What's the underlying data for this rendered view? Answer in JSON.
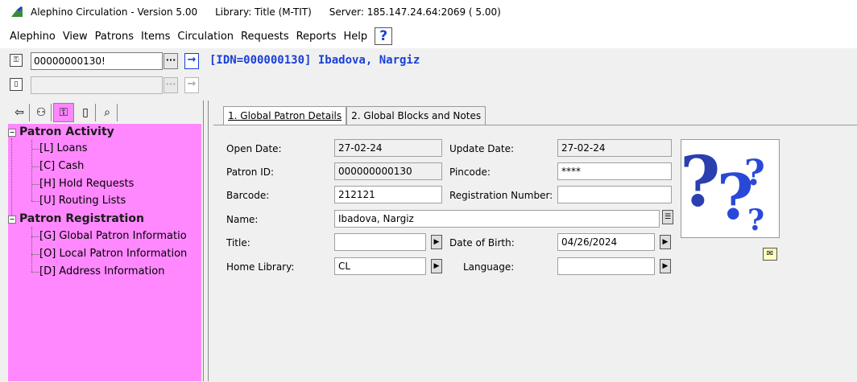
{
  "titlebar": {
    "app_title": "Alephino Circulation - Version 5.00",
    "library": "Library: Title (M-TIT)",
    "server": "Server: 185.147.24.64:2069 ( 5.00)"
  },
  "menu": {
    "items": [
      "Alephino",
      "View",
      "Patrons",
      "Items",
      "Circulation",
      "Requests",
      "Reports",
      "Help"
    ],
    "help_icon": "?"
  },
  "toolbar": {
    "patron_input_value": "00000000130!",
    "dots_label": "···",
    "go_arrow": "→",
    "patron_heading": "[IDN=000000130] Ibadova, Nargiz",
    "second_input_value": ""
  },
  "left_tabs": {
    "icons": [
      "exit-icon",
      "patron-icon",
      "patron-active-icon",
      "page-icon",
      "binoculars-icon"
    ]
  },
  "tree": {
    "groups": [
      {
        "label": "Patron Activity",
        "items": [
          "[L] Loans",
          "[C] Cash",
          "[H] Hold Requests",
          "[U] Routing Lists"
        ]
      },
      {
        "label": "Patron Registration",
        "items": [
          "[G] Global Patron Informatio",
          "[O] Local Patron Information",
          "[D] Address Information"
        ]
      }
    ]
  },
  "page_tabs": {
    "tab1": "1. Global Patron Details",
    "tab2": "2. Global Blocks and Notes"
  },
  "form": {
    "open_date_label": "Open Date:",
    "open_date": "27-02-24",
    "update_date_label": "Update Date:",
    "update_date": "27-02-24",
    "patron_id_label": "Patron ID:",
    "patron_id": "000000000130",
    "pincode_label": "Pincode:",
    "pincode": "****",
    "barcode_label": "Barcode:",
    "barcode": "212121",
    "registration_label": "Registration Number:",
    "registration": "",
    "name_label": "Name:",
    "name": "Ibadova, Nargiz",
    "title_label": "Title:",
    "title": "",
    "dob_label": "Date of Birth:",
    "dob": "04/26/2024",
    "home_library_label": "Home Library:",
    "home_library": "CL",
    "language_label": "Language:",
    "language": ""
  },
  "colors": {
    "tree_bg": "#ff88ff",
    "heading_blue": "#1a3fd6"
  }
}
